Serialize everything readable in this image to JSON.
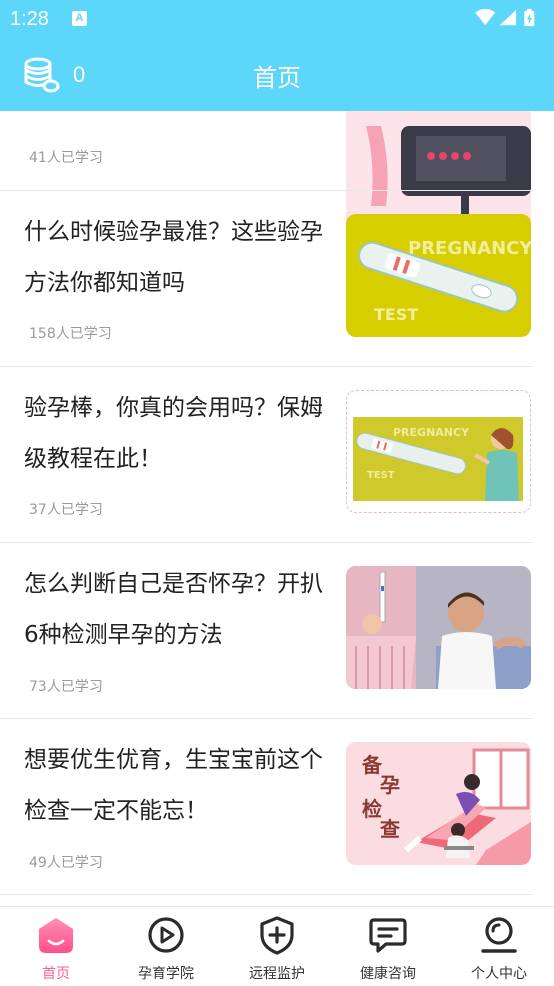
{
  "status_bar": {
    "time": "1:28",
    "notification_letter": "A"
  },
  "header": {
    "coin_count": "0",
    "title": "首页"
  },
  "feed": {
    "items": [
      {
        "title": "",
        "learn_count": "41人已学习",
        "thumb": "pregnancy-test-device"
      },
      {
        "title": "什么时候验孕最准？这些验孕方法你都知道吗",
        "learn_count": "158人已学习",
        "thumb": "pregnancy-test-yellow",
        "thumb_text": [
          "PREGNANCY",
          "TEST"
        ]
      },
      {
        "title": "验孕棒，你真的会用吗？保姆级教程在此！",
        "learn_count": "37人已学习",
        "thumb": "pregnancy-test-woman",
        "thumb_text": [
          "PREGNANCY",
          "TEST"
        ]
      },
      {
        "title": "怎么判断自己是否怀孕？开扒6种检测早孕的方法",
        "learn_count": "73人已学习",
        "thumb": "couple-test-photo"
      },
      {
        "title": "想要优生优育，生宝宝前这个检查一定不能忘！",
        "learn_count": "49人已学习",
        "thumb": "pre-pregnancy-check",
        "thumb_text": [
          "备",
          "孕",
          "检",
          "查"
        ]
      }
    ]
  },
  "bottom_nav": {
    "tabs": [
      {
        "label": "首页",
        "icon": "home-icon",
        "active": true
      },
      {
        "label": "孕育学院",
        "icon": "play-circle-icon",
        "active": false
      },
      {
        "label": "远程监护",
        "icon": "shield-plus-icon",
        "active": false
      },
      {
        "label": "健康咨询",
        "icon": "chat-icon",
        "active": false
      },
      {
        "label": "个人中心",
        "icon": "profile-icon",
        "active": false
      }
    ]
  },
  "colors": {
    "primary": "#5cd6f9",
    "accent": "#ff5f95",
    "text": "#222222",
    "muted": "#9a9a9a"
  }
}
